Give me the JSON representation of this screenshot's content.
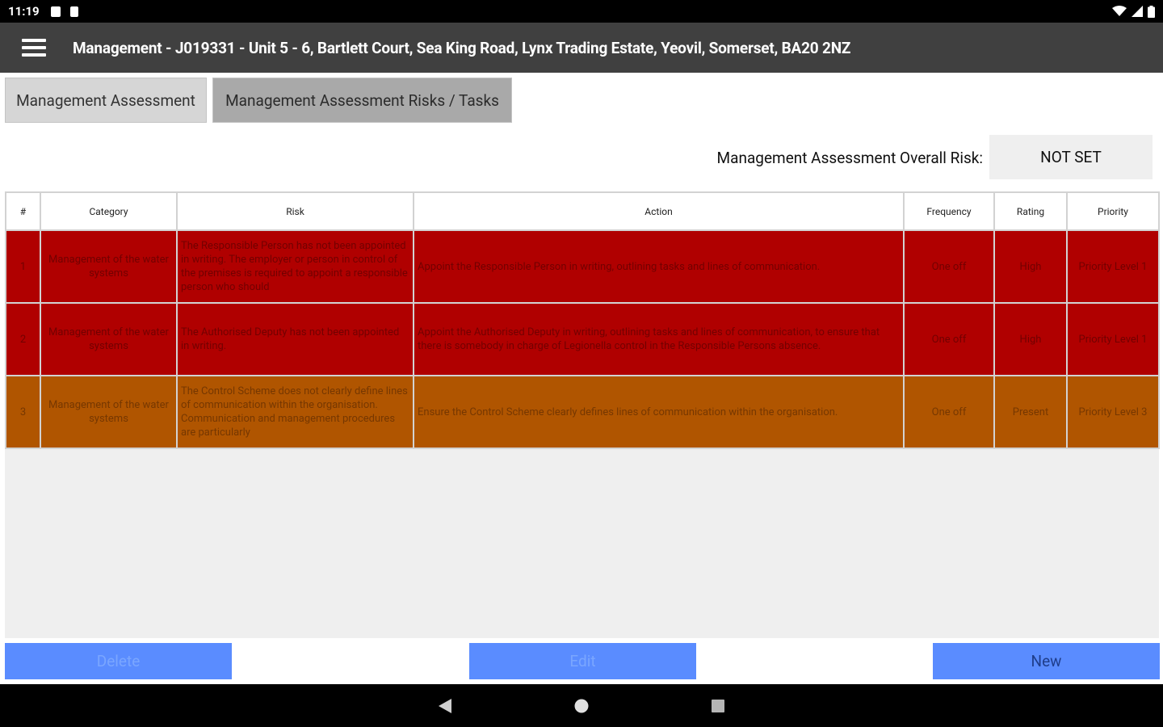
{
  "status": {
    "time": "11:19"
  },
  "app_bar": {
    "title": "Management - J019331 - Unit 5 - 6, Bartlett Court, Sea King Road, Lynx Trading Estate, Yeovil, Somerset, BA20 2NZ"
  },
  "tabs": [
    {
      "label": "Management Assessment",
      "selected": false
    },
    {
      "label": "Management Assessment Risks / Tasks",
      "selected": true
    }
  ],
  "overall_risk": {
    "label": "Management Assessment Overall Risk:",
    "value": "NOT SET"
  },
  "table": {
    "headers": [
      "#",
      "Category",
      "Risk",
      "Action",
      "Frequency",
      "Rating",
      "Priority"
    ],
    "rows": [
      {
        "num": "1",
        "category": "Management of the water systems",
        "risk": "The Responsible Person has not been appointed in writing. The employer or person in control of the premises is required to appoint a responsible person who should",
        "action": "Appoint the Responsible Person in writing, outlining tasks and lines of communication.",
        "frequency": "One off",
        "rating": "High",
        "priority": "Priority Level 1",
        "level": "red"
      },
      {
        "num": "2",
        "category": "Management of the water systems",
        "risk": "The Authorised Deputy has not been appointed in writing.",
        "action": "Appoint the Authorised Deputy in writing, outlining tasks and lines of communication, to ensure that there is somebody in charge of Legionella control in the Responsible Persons absence.",
        "frequency": "One off",
        "rating": "High",
        "priority": "Priority Level 1",
        "level": "red"
      },
      {
        "num": "3",
        "category": "Management of the water systems",
        "risk": "The Control Scheme does not clearly define lines of communication within the organisation. Communication and management procedures are particularly",
        "action": "Ensure the Control Scheme clearly defines lines of communication within the organisation.",
        "frequency": "One off",
        "rating": "Present",
        "priority": "Priority Level 3",
        "level": "orange"
      }
    ]
  },
  "buttons": {
    "delete": "Delete",
    "edit": "Edit",
    "new": "New"
  },
  "colors": {
    "app_bar": "#404040",
    "row_red": "#b00000",
    "row_orange": "#b05500",
    "button": "#5a8cff"
  },
  "icons": {
    "menu": "hamburger-icon",
    "back": "back-triangle-icon",
    "home": "home-circle-icon",
    "recents": "recents-square-icon"
  }
}
